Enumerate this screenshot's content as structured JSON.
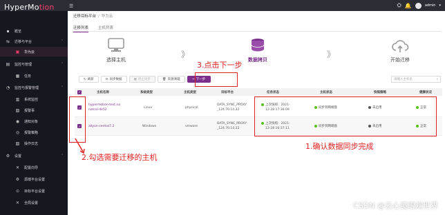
{
  "app": {
    "logo_main": "HyperMo",
    "logo_accent": "tion",
    "menu_icon": "hamburger-icon",
    "user": "admin"
  },
  "sidebar": {
    "items": [
      {
        "label": "概览",
        "icon": "dashboard-icon"
      },
      {
        "label": "迁移与平台",
        "icon": "migrate-icon"
      },
      {
        "label": "华为云",
        "icon": "cloud-icon",
        "active": true
      },
      {
        "label": "监控与管理",
        "icon": "monitor-icon"
      },
      {
        "label": "任务",
        "icon": "task-icon"
      },
      {
        "label": "监控与报警管理",
        "icon": "bell-icon"
      },
      {
        "label": "系统监控",
        "icon": "chart-icon"
      },
      {
        "label": "报警事",
        "icon": "warning-icon"
      },
      {
        "label": "通知对象",
        "icon": "user-icon"
      },
      {
        "label": "报警策略",
        "icon": "policy-icon"
      },
      {
        "label": "操作日志",
        "icon": "log-icon"
      },
      {
        "label": "设置",
        "icon": "gear-icon"
      },
      {
        "label": "配置向导",
        "icon": "wand-icon"
      },
      {
        "label": "源端平台设置",
        "icon": "source-icon"
      },
      {
        "label": "目标平台设置",
        "icon": "target-icon"
      },
      {
        "label": "全局设置",
        "icon": "global-icon"
      }
    ]
  },
  "breadcrumb": {
    "parent": "迁移目标平台",
    "sep": "/",
    "current": "华为云"
  },
  "tabs": [
    {
      "label": "迁移列表",
      "active": true
    },
    {
      "label": "主机列表",
      "active": false
    }
  ],
  "steps": [
    {
      "label": "选择主机",
      "icon": "host-icon"
    },
    {
      "label": "数据拷贝",
      "icon": "database-icon",
      "active": true
    },
    {
      "label": "开始迁移",
      "icon": "cloud-upload-icon"
    }
  ],
  "step_arrow": "》",
  "toolbar": {
    "refresh": "刷新",
    "sync": "同步数据",
    "stop_sync": "停止同步",
    "clear": "资源清理",
    "next": "下一步"
  },
  "search": {
    "placeholder": "请输入主机名"
  },
  "table": {
    "headers": [
      "主机名称",
      "系统类型",
      "主机类型",
      "目标平台",
      "任务状态",
      "主机状态",
      "快照策略",
      "健康状况"
    ],
    "rows": [
      {
        "name": "hypermotion-test.na",
        "name2": "natcal-4k52",
        "os": "Linux",
        "type": "physical",
        "target": "DATA_SYNC_PROXY",
        "target2": "_124.70.14.22",
        "task": "上次快照：2021-",
        "task2": "12-28 17:36:09",
        "host_status": "同步到网端盘",
        "snapshot": "未启用",
        "health": "正常"
      },
      {
        "name": "allyun-centos7.2",
        "name2": "",
        "os": "Windows",
        "type": "vmware",
        "target": "DATA_SYNC_PROXY",
        "target2": "_124.70.14.22",
        "task": "上次快照：2021-",
        "task2": "12-28 16:37:11",
        "host_status": "同步到网端盘",
        "snapshot": "未启用",
        "health": "正常"
      }
    ]
  },
  "annotations": {
    "step3": "3.点击下一步",
    "step2": "2.勾选需要迁移的主机",
    "step1": "1.确认数据同步完成",
    "color": "#e02020"
  },
  "watermark": "CSDN @云心笺眼观世界",
  "colors": {
    "accent": "#7a2f8a",
    "brand": "#ff3c6f",
    "sidebar": "#16181f"
  }
}
